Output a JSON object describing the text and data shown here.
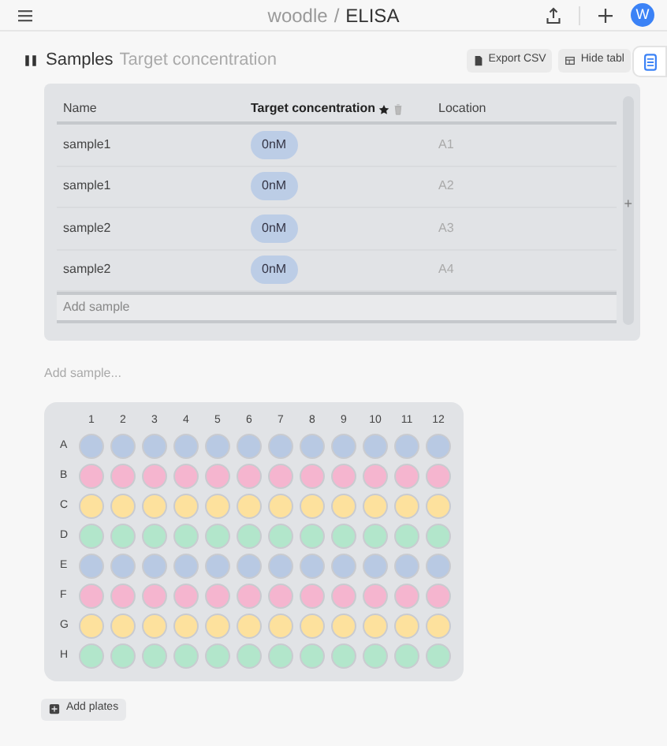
{
  "breadcrumb": {
    "workspace": "woodle",
    "separator": "/",
    "page": "ELISA"
  },
  "avatar": "W",
  "section": {
    "title": "Samples",
    "subtitle": "Target concentration",
    "buttons": [
      "Export CSV",
      "Hide tabl"
    ]
  },
  "table": {
    "columns": [
      {
        "label": "Name",
        "bold": false,
        "starred": false
      },
      {
        "label": "Target concentration",
        "bold": true,
        "starred": true
      },
      {
        "label": "Location",
        "bold": false,
        "starred": false
      }
    ],
    "rows": [
      {
        "name": "sample1",
        "concentration": "0nM",
        "location": "A1"
      },
      {
        "name": "sample1",
        "concentration": "0nM",
        "location": "A2"
      },
      {
        "name": "sample2",
        "concentration": "0nM",
        "location": "A3"
      },
      {
        "name": "sample2",
        "concentration": "0nM",
        "location": "A4"
      }
    ],
    "add_row": "Add sample",
    "add_column": "+"
  },
  "sample_input": {
    "placeholder": "Add sample..."
  },
  "plate": {
    "columns": [
      "1",
      "2",
      "3",
      "4",
      "5",
      "6",
      "7",
      "8",
      "9",
      "10",
      "11",
      "12"
    ],
    "rows": [
      {
        "label": "A",
        "color": "#b8c9e3"
      },
      {
        "label": "B",
        "color": "#f5b5cf"
      },
      {
        "label": "C",
        "color": "#fde19d"
      },
      {
        "label": "D",
        "color": "#b2e6cb"
      },
      {
        "label": "E",
        "color": "#b8c9e3"
      },
      {
        "label": "F",
        "color": "#f5b5cf"
      },
      {
        "label": "G",
        "color": "#fde19d"
      },
      {
        "label": "H",
        "color": "#b2e6cb"
      }
    ]
  },
  "add_plates": "Add plates"
}
